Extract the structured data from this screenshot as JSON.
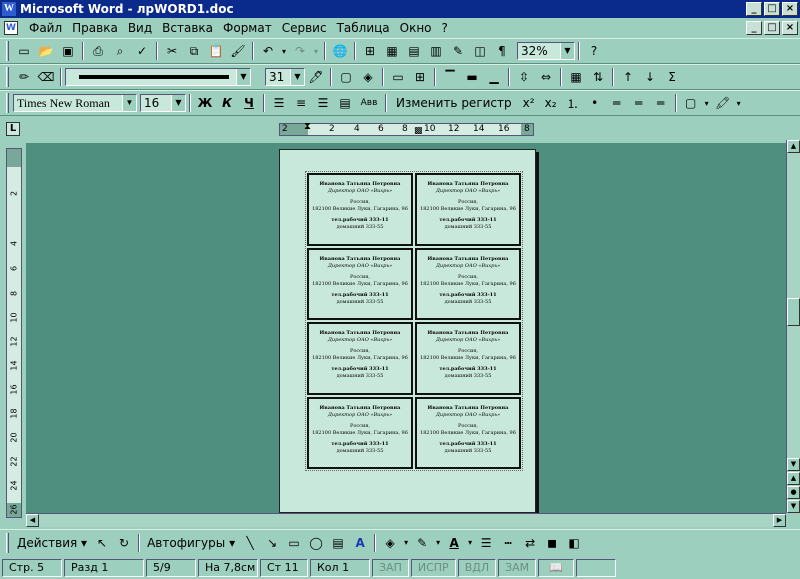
{
  "window": {
    "title": "Microsoft Word - лрWORD1.doc",
    "controls": {
      "minimize": "_",
      "maximize": "□",
      "close": "×"
    }
  },
  "menu": {
    "items": [
      "Файл",
      "Правка",
      "Вид",
      "Вставка",
      "Формат",
      "Сервис",
      "Таблица",
      "Окно",
      "?"
    ]
  },
  "toolbar_standard": {
    "zoom": "32%"
  },
  "toolbar_drawing_lines": {
    "line_width": "31"
  },
  "toolbar_format": {
    "font": "Times New Roman",
    "size": "16",
    "bold": "Ж",
    "italic": "К",
    "underline": "Ч",
    "abv": "Авв",
    "change_case": "Изменить регистр",
    "superscript": "x²",
    "subscript": "x₂"
  },
  "hruler": {
    "labels": [
      "2",
      "2",
      "4",
      "6",
      "8",
      "10",
      "12",
      "14",
      "16",
      "8"
    ]
  },
  "vruler": {
    "labels": [
      "2",
      "4",
      "6",
      "8",
      "10",
      "12",
      "14",
      "16",
      "18",
      "20",
      "22",
      "24",
      "26"
    ]
  },
  "card": {
    "name": "Иванова Татьяна Петровна",
    "role": "Директор ОАО «Вихрь»",
    "country": "Россия,",
    "address": "182100 Великие Луки, Гагарина, 96",
    "tel1": "тел.рабочий 333-11",
    "tel2": "домашний 333-55"
  },
  "drawbar": {
    "actions": "Действия ▾",
    "autoshapes": "Автофигуры ▾"
  },
  "status": {
    "page": "Стр. 5",
    "section": "Разд 1",
    "pages": "5/9",
    "at": "На 7,8см",
    "line": "Ст 11",
    "col": "Кол 1",
    "rec": "ЗАП",
    "trk": "ИСПР",
    "ext": "ВДЛ",
    "ovr": "ЗАМ"
  }
}
